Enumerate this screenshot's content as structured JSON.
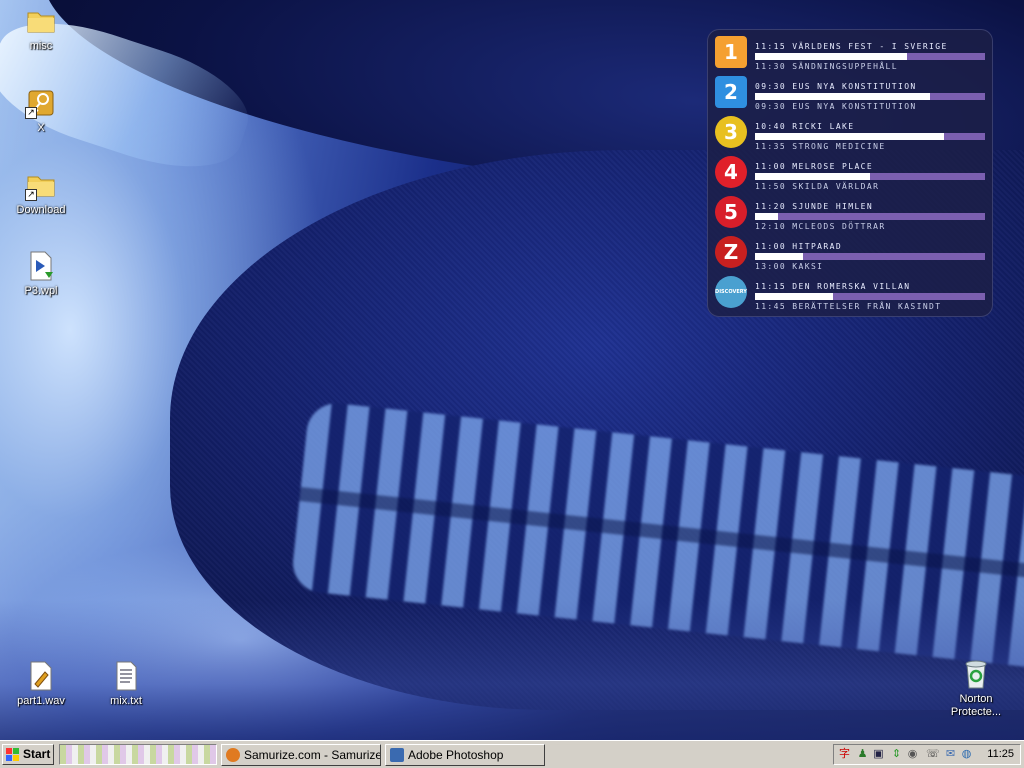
{
  "desktop": {
    "icons": [
      {
        "label": "misc",
        "type": "folder-icon"
      },
      {
        "label": "X",
        "type": "key-shortcut-icon"
      },
      {
        "label": "Download",
        "type": "folder-shortcut-icon"
      },
      {
        "label": "P3.wpl",
        "type": "playlist-file-icon"
      },
      {
        "label": "part1.wav",
        "type": "wav-file-icon"
      },
      {
        "label": "mix.txt",
        "type": "text-file-icon"
      },
      {
        "label": "Norton Protecte...",
        "type": "recycle-bin-icon"
      }
    ]
  },
  "tv_widget": {
    "channels": [
      {
        "logo": "1",
        "logo_color": "#f5a031",
        "now": "11:15 världens fest - i sverige",
        "next": "11:30 sändningsuppehåll",
        "progress": 0.66
      },
      {
        "logo": "2",
        "logo_color": "#2f8fe0",
        "now": "09:30 eus nya konstitution",
        "next": "09:30 eus nya konstitution",
        "progress": 0.76
      },
      {
        "logo": "3",
        "logo_color": "#e8c020",
        "now": "10:40 ricki lake",
        "next": "11:35 strong medicine",
        "progress": 0.82
      },
      {
        "logo": "4",
        "logo_color": "#e0202a",
        "now": "11:00 melrose place",
        "next": "11:50 skilda världar",
        "progress": 0.5
      },
      {
        "logo": "5",
        "logo_color": "#d81e2a",
        "now": "11:20 sjunde himlen",
        "next": "12:10 mcleods döttrar",
        "progress": 0.1
      },
      {
        "logo": "Z",
        "logo_color": "#c82020",
        "now": "11:00 hitparad",
        "next": "13:00 kaksi",
        "progress": 0.21
      },
      {
        "logo": "DISCOVERY",
        "logo_color": "#4aa0d0",
        "now": "11:15 den romerska villan",
        "next": "11:45 berättelser från kasindt",
        "progress": 0.34
      }
    ]
  },
  "taskbar": {
    "start_label": "Start",
    "tasks": [
      {
        "label": "Samurize.com - Samurize...",
        "icon": "firefox-icon",
        "icon_color": "#e07a20"
      },
      {
        "label": "Adobe Photoshop",
        "icon": "photoshop-icon",
        "icon_color": "#3a6ab0"
      }
    ],
    "clock": "11:25",
    "tray_icons": [
      "chinese-input-icon",
      "network-person-icon",
      "monitor-icon",
      "arrows-icon",
      "speaker-icon",
      "phone-icon",
      "mail-icon",
      "globe-icon"
    ]
  }
}
